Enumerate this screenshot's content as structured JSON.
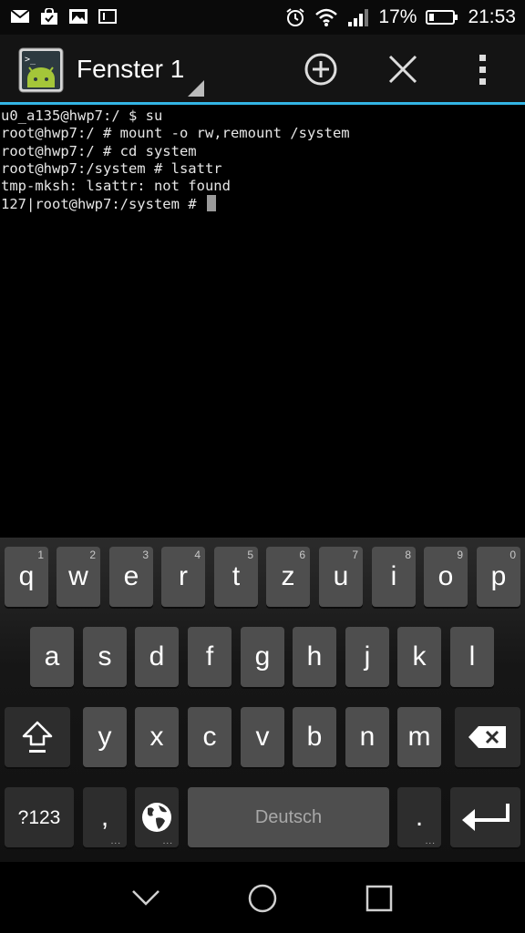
{
  "status_bar": {
    "battery_percent": "17%",
    "time": "21:53",
    "left_icons": [
      "mail-icon",
      "shopping-bag-icon",
      "gallery-icon",
      "sim-icon"
    ],
    "right_icons": [
      "alarm-icon",
      "wifi-icon",
      "signal-icon",
      "battery-icon"
    ]
  },
  "action_bar": {
    "window_title": "Fenster 1",
    "icons": [
      "terminal-app-icon",
      "add-window-icon",
      "close-window-icon",
      "overflow-menu-icon"
    ],
    "accent_color": "#33b5e5"
  },
  "terminal": {
    "lines": [
      "u0_a135@hwp7:/ $ su",
      "root@hwp7:/ # mount -o rw,remount /system",
      "root@hwp7:/ # cd system",
      "root@hwp7:/system # lsattr",
      "tmp-mksh: lsattr: not found",
      "127|root@hwp7:/system # "
    ]
  },
  "keyboard": {
    "row1": [
      {
        "label": "q",
        "hint": "1"
      },
      {
        "label": "w",
        "hint": "2"
      },
      {
        "label": "e",
        "hint": "3"
      },
      {
        "label": "r",
        "hint": "4"
      },
      {
        "label": "t",
        "hint": "5"
      },
      {
        "label": "z",
        "hint": "6"
      },
      {
        "label": "u",
        "hint": "7"
      },
      {
        "label": "i",
        "hint": "8"
      },
      {
        "label": "o",
        "hint": "9"
      },
      {
        "label": "p",
        "hint": "0"
      }
    ],
    "row2": [
      "a",
      "s",
      "d",
      "f",
      "g",
      "h",
      "j",
      "k",
      "l"
    ],
    "row3": [
      "y",
      "x",
      "c",
      "v",
      "b",
      "n",
      "m"
    ],
    "symbols_label": "?123",
    "comma_label": ",",
    "space_label": "Deutsch",
    "period_label": ".",
    "icons": [
      "shift-icon",
      "backspace-icon",
      "globe-icon",
      "enter-icon"
    ]
  },
  "nav_bar": {
    "icons": [
      "back-icon",
      "home-icon",
      "recents-icon"
    ]
  }
}
